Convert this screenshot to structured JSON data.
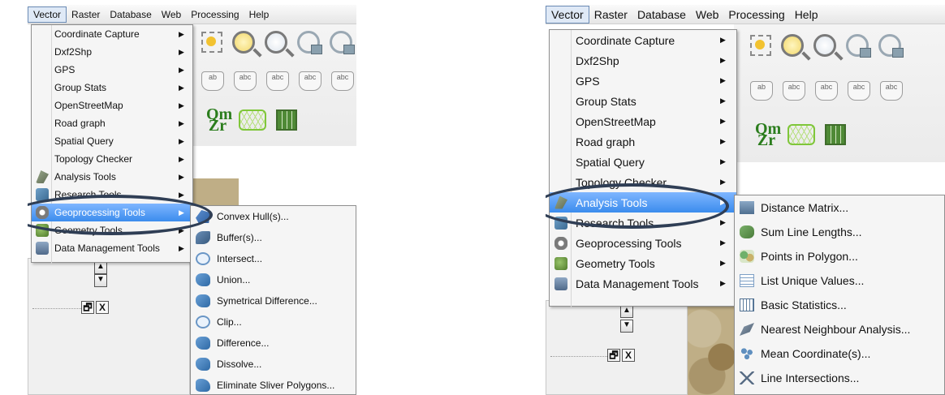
{
  "screenshots": [
    {
      "menubar": [
        "Vector",
        "Raster",
        "Database",
        "Web",
        "Processing",
        "Help"
      ],
      "menubar_active": "Vector",
      "vector_menu": [
        {
          "label": "Coordinate Capture"
        },
        {
          "label": "Dxf2Shp"
        },
        {
          "label": "GPS"
        },
        {
          "label": "Group Stats"
        },
        {
          "label": "OpenStreetMap"
        },
        {
          "label": "Road graph"
        },
        {
          "label": "Spatial Query"
        },
        {
          "label": "Topology Checker"
        },
        {
          "label": "Analysis Tools",
          "icon": "analysis-tools-icon"
        },
        {
          "label": "Research Tools",
          "icon": "research-tools-icon"
        },
        {
          "label": "Geoprocessing Tools",
          "icon": "geoprocessing-icon",
          "highlighted": true
        },
        {
          "label": "Geometry Tools",
          "icon": "geometry-tools-icon"
        },
        {
          "label": "Data Management Tools",
          "icon": "data-management-icon"
        }
      ],
      "submenu": [
        {
          "label": "Convex Hull(s)...",
          "icon": "convex-hull-icon"
        },
        {
          "label": "Buffer(s)...",
          "icon": "buffer-icon"
        },
        {
          "label": "Intersect...",
          "icon": "intersect-icon"
        },
        {
          "label": "Union...",
          "icon": "union-icon"
        },
        {
          "label": "Symetrical Difference...",
          "icon": "symmetrical-difference-icon"
        },
        {
          "label": "Clip...",
          "icon": "clip-icon"
        },
        {
          "label": "Difference...",
          "icon": "difference-icon"
        },
        {
          "label": "Dissolve...",
          "icon": "dissolve-icon"
        },
        {
          "label": "Eliminate Sliver Polygons...",
          "icon": "eliminate-sliver-icon"
        }
      ],
      "dock_buttons": {
        "float": "🗗",
        "close": "X"
      },
      "scroll": {
        "up": "▲",
        "down": "▼"
      },
      "label_icons": [
        "ab",
        "abc",
        "abc",
        "abc",
        "abc"
      ],
      "qm_icon": "Qm\nZr"
    },
    {
      "menubar": [
        "Vector",
        "Raster",
        "Database",
        "Web",
        "Processing",
        "Help"
      ],
      "menubar_active": "Vector",
      "vector_menu": [
        {
          "label": "Coordinate Capture"
        },
        {
          "label": "Dxf2Shp"
        },
        {
          "label": "GPS"
        },
        {
          "label": "Group Stats"
        },
        {
          "label": "OpenStreetMap"
        },
        {
          "label": "Road graph"
        },
        {
          "label": "Spatial Query"
        },
        {
          "label": "Topology Checker"
        },
        {
          "label": "Analysis Tools",
          "icon": "analysis-tools-icon",
          "highlighted": true
        },
        {
          "label": "Research Tools",
          "icon": "research-tools-icon"
        },
        {
          "label": "Geoprocessing Tools",
          "icon": "geoprocessing-icon"
        },
        {
          "label": "Geometry Tools",
          "icon": "geometry-tools-icon"
        },
        {
          "label": "Data Management Tools",
          "icon": "data-management-icon"
        }
      ],
      "submenu": [
        {
          "label": "Distance Matrix...",
          "icon": "distance-matrix-icon"
        },
        {
          "label": "Sum Line Lengths...",
          "icon": "sum-line-lengths-icon"
        },
        {
          "label": "Points in Polygon...",
          "icon": "points-in-polygon-icon"
        },
        {
          "label": "List Unique Values...",
          "icon": "list-unique-values-icon"
        },
        {
          "label": "Basic Statistics...",
          "icon": "basic-statistics-icon"
        },
        {
          "label": "Nearest Neighbour Analysis...",
          "icon": "nearest-neighbour-icon"
        },
        {
          "label": "Mean Coordinate(s)...",
          "icon": "mean-coordinate-icon"
        },
        {
          "label": "Line Intersections...",
          "icon": "line-intersections-icon"
        }
      ],
      "dock_buttons": {
        "float": "🗗",
        "close": "X"
      },
      "scroll": {
        "up": "▲",
        "down": "▼"
      },
      "label_icons": [
        "ab",
        "abc",
        "abc",
        "abc",
        "abc"
      ],
      "qm_icon": "Qm\nZr"
    }
  ]
}
